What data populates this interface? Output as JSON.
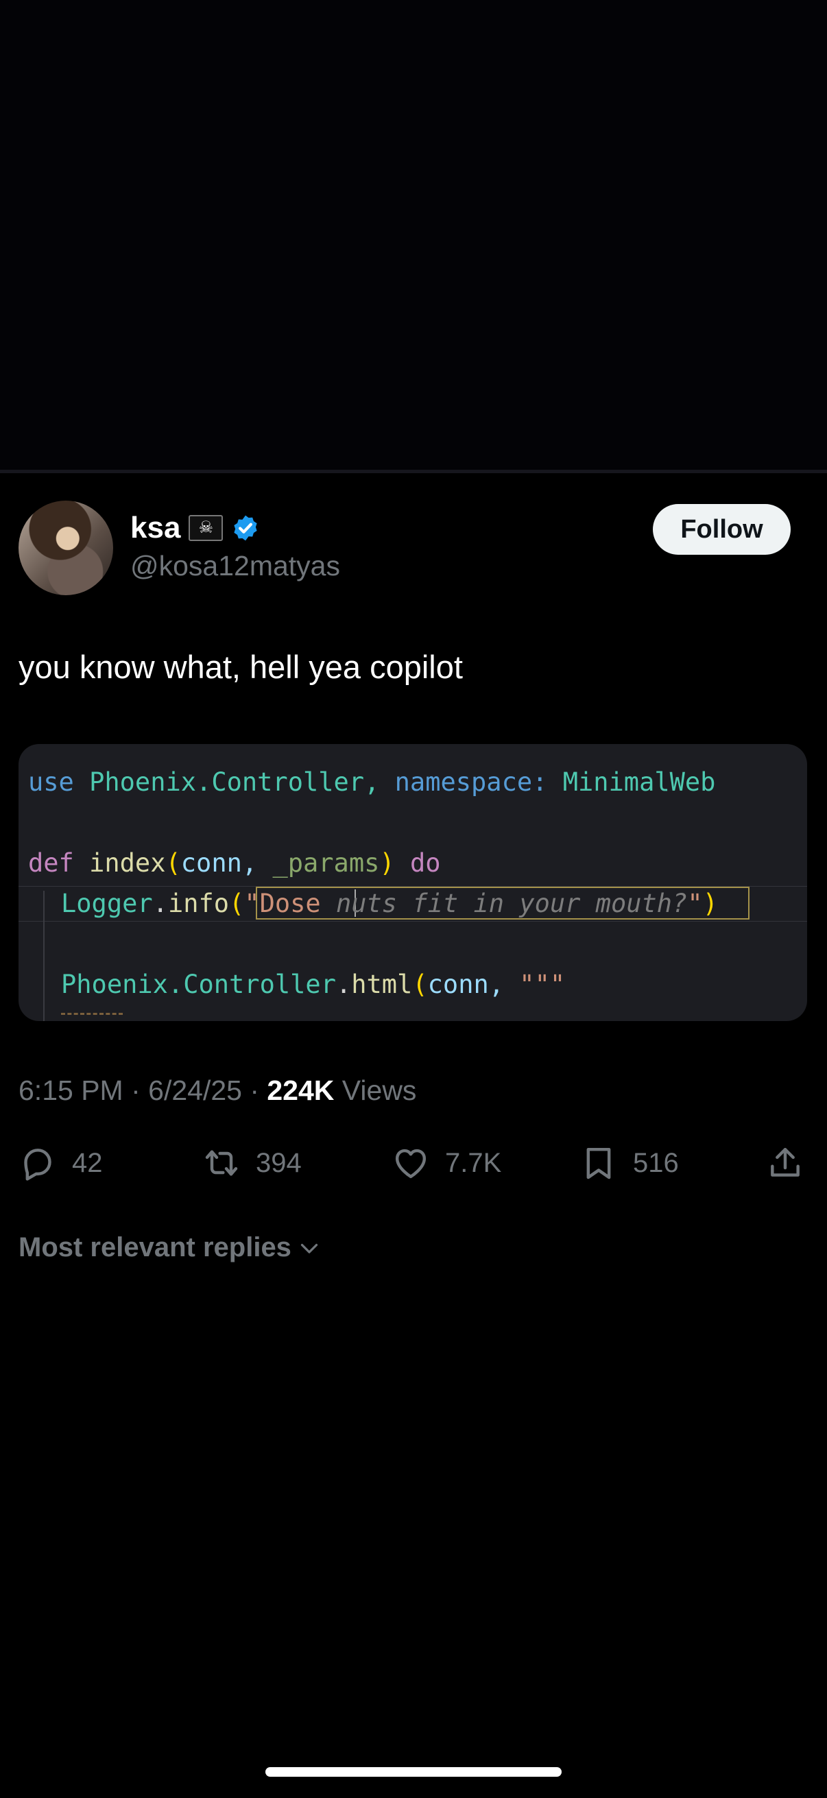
{
  "author": {
    "display_name": "ksa",
    "flag_emoji": "☠",
    "handle": "@kosa12matyas"
  },
  "follow_label": "Follow",
  "tweet_text": "you know what, hell yea copilot",
  "code": {
    "line1": {
      "kw": "use",
      "module": "Phoenix.Controller,",
      "opt": "namespace:",
      "value": "MinimalWeb"
    },
    "line2": {
      "kw": "def",
      "fn": "index",
      "open": "(",
      "arg1": "conn,",
      "arg2": "_params",
      "close": ")",
      "kw2": "do"
    },
    "line3": {
      "obj": "Logger",
      "dot": ".",
      "fn": "info",
      "open": "(",
      "str": "\"Dose ",
      "ghost": "nuts fit in your mouth?",
      "str_end": "\"",
      "close": ")"
    },
    "line4": {
      "module": "Phoenix.Controller",
      "dot": ".",
      "fn": "html",
      "open": "(",
      "arg": "conn, ",
      "str": "\"\"\""
    }
  },
  "meta": {
    "time": "6:15 PM",
    "date": "6/24/25",
    "views_count": "224K",
    "views_label": "Views"
  },
  "actions": {
    "replies": "42",
    "reposts": "394",
    "likes": "7.7K",
    "bookmarks": "516"
  },
  "replies_sort_label": "Most relevant replies",
  "colors": {
    "verified": "#1d9bf0",
    "muted": "#71767b",
    "code_bg": "#1c1d22"
  }
}
